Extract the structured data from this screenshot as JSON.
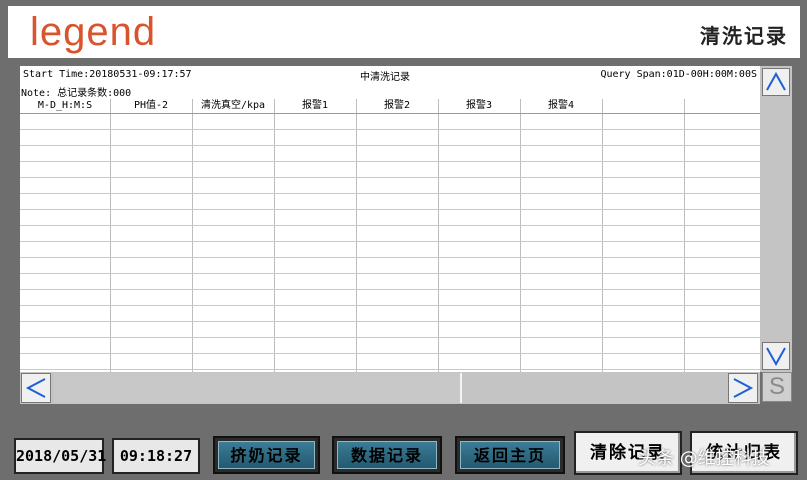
{
  "header": {
    "logo": "legend",
    "title": "清洗记录"
  },
  "panel": {
    "start_time": "Start Time:20180531-09:17:57",
    "center_title": "中清洗记录",
    "query_span": "Query Span:01D-00H:00M:00S",
    "note": "Note: 总记录条数:000",
    "columns": [
      "M-D_H:M:S",
      "PH值-2",
      "清洗真空/kpa",
      "报警1",
      "报警2",
      "报警3",
      "报警4",
      "",
      ""
    ]
  },
  "scroll": {
    "up_icon": "triangle-up-icon",
    "down_icon": "triangle-down-icon",
    "left_icon": "triangle-left-icon",
    "right_icon": "triangle-right-icon",
    "corner_label": "S"
  },
  "footer": {
    "date": "2018/05/31",
    "time": "09:18:27",
    "btn_milking": "挤奶记录",
    "btn_data": "数据记录",
    "btn_home": "返回主页",
    "btn_clear": "清除记录",
    "btn_partial": "统计归表",
    "watermark": "头条 @维控科技"
  },
  "colors": {
    "logo": "#d9542e",
    "arrow": "#1f5fd6",
    "panel_bg": "#6e6e6e"
  }
}
